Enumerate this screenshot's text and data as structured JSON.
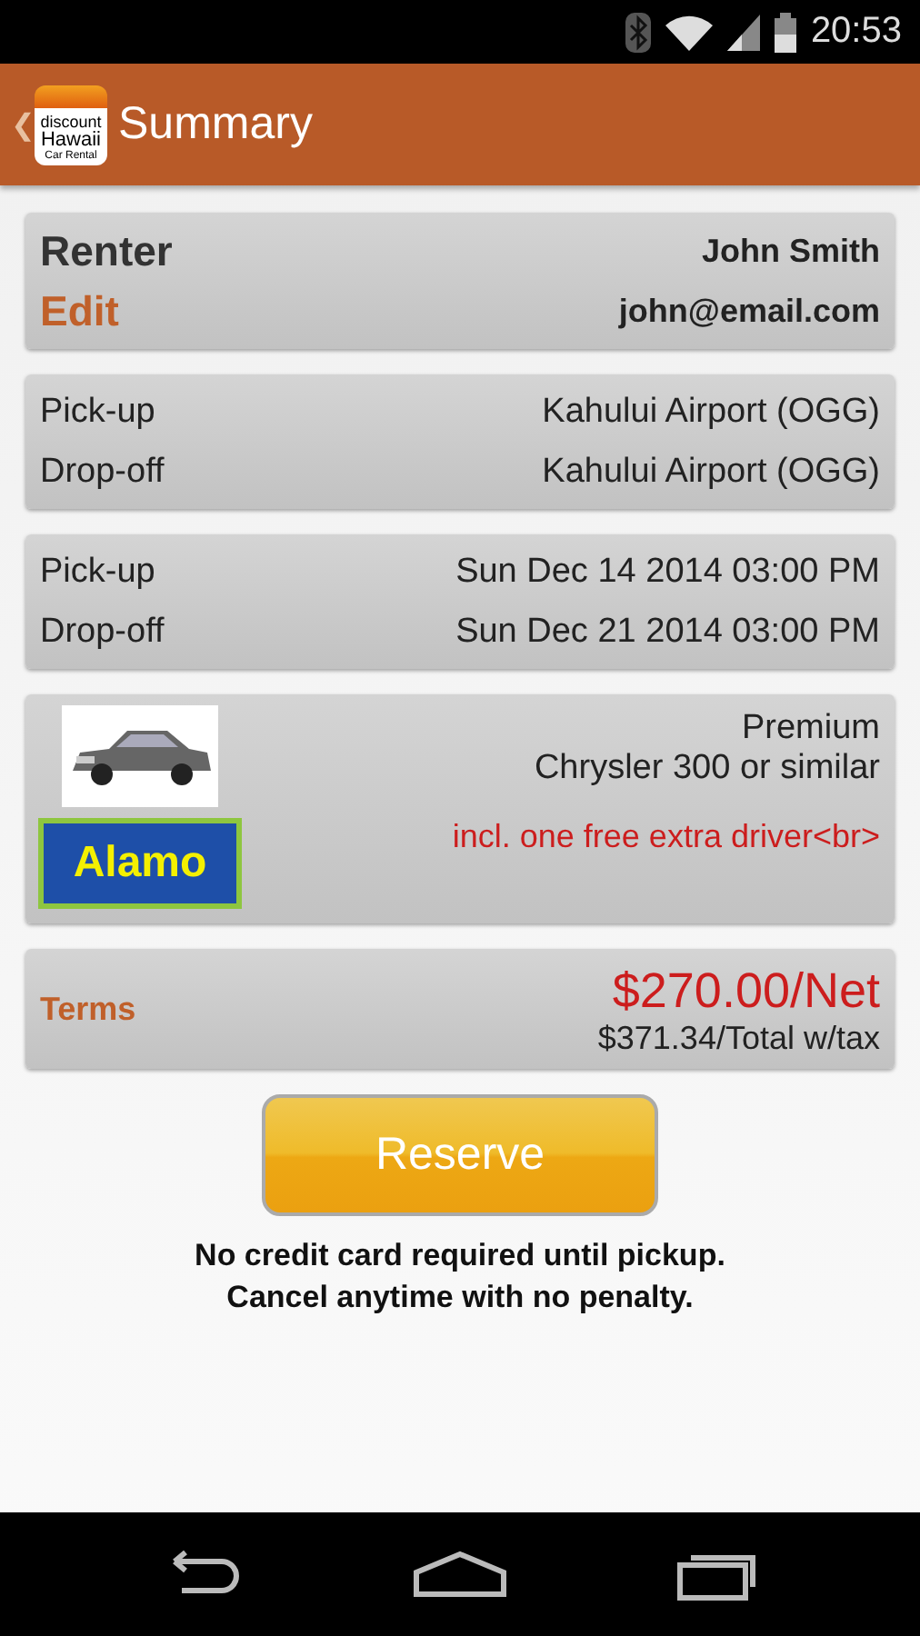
{
  "status_bar": {
    "time": "20:53"
  },
  "app_bar": {
    "back": "❮",
    "logo": [
      "discount",
      "Hawaii",
      "Car Rental"
    ],
    "title": "Summary"
  },
  "renter": {
    "heading": "Renter",
    "edit": "Edit",
    "name": "John Smith",
    "email": "john@email.com"
  },
  "locations": [
    {
      "label": "Pick-up",
      "value": "Kahului Airport (OGG)"
    },
    {
      "label": "Drop-off",
      "value": "Kahului Airport (OGG)"
    }
  ],
  "dates": [
    {
      "label": "Pick-up",
      "value": "Sun Dec 14 2014 03:00 PM"
    },
    {
      "label": "Drop-off",
      "value": "Sun Dec 21 2014 03:00 PM"
    }
  ],
  "vehicle": {
    "vendor_logo": "Alamo",
    "class": "Premium",
    "model": "Chrysler 300 or similar",
    "note": "incl. one free extra driver<br>"
  },
  "pricing": {
    "terms": "Terms",
    "net": "$270.00/Net",
    "total": "$371.34/Total w/tax"
  },
  "reserve_button": "Reserve",
  "notes": [
    "No credit card required until pickup.",
    "Cancel anytime with no penalty."
  ]
}
